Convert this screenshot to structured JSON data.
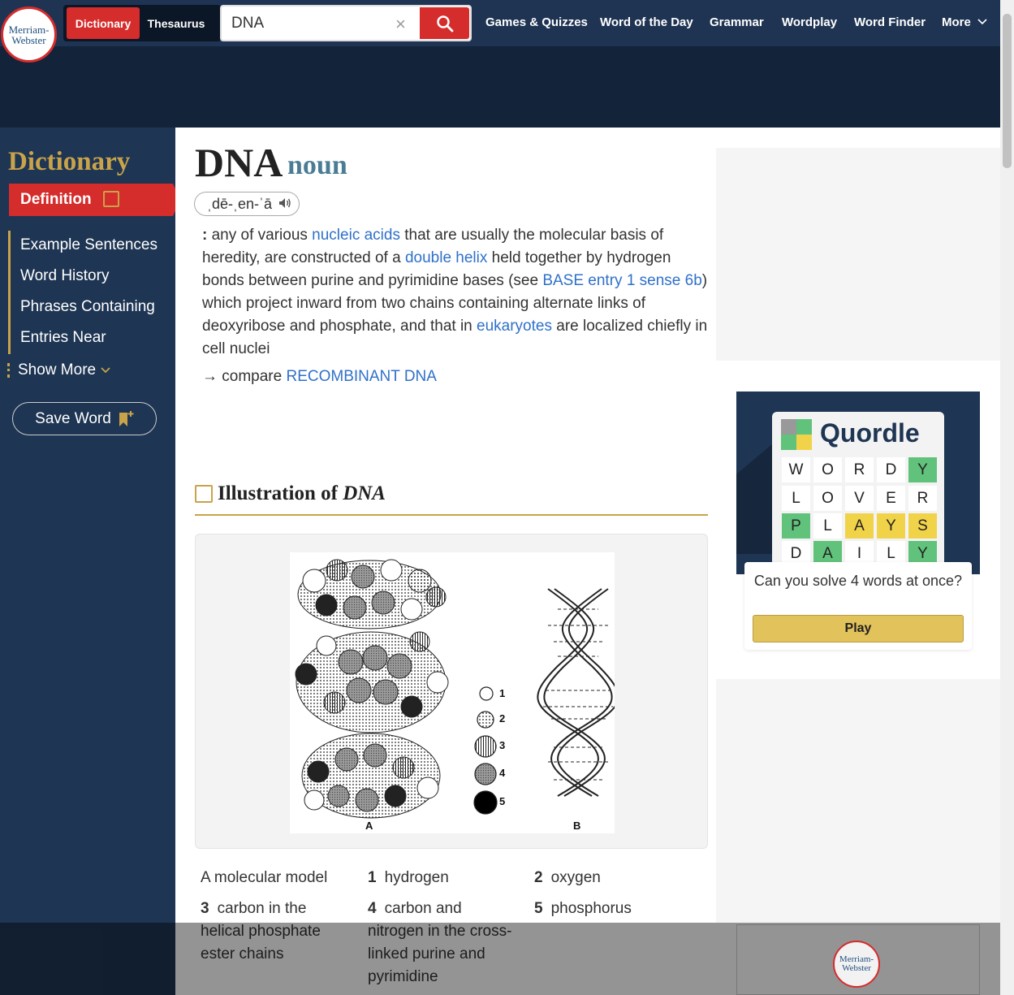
{
  "header": {
    "logo_line1": "Merriam-",
    "logo_line2": "Webster",
    "tab_dictionary": "Dictionary",
    "tab_thesaurus": "Thesaurus",
    "search_value": "DNA",
    "clear_glyph": "×",
    "nav": [
      "Games & Quizzes",
      "Word of the Day",
      "Grammar",
      "Wordplay",
      "Word Finder",
      "More"
    ]
  },
  "sidebar": {
    "title": "Dictionary",
    "active": "Definition",
    "items": [
      "Example Sentences",
      "Word History",
      "Phrases Containing",
      "Entries Near"
    ],
    "show_more": "Show More",
    "save_word": "Save Word"
  },
  "entry": {
    "headword": "DNA",
    "pos": "noun",
    "pronunciation": "ˌdē-ˌen-ˈā",
    "def_colon": ":",
    "def_parts": {
      "p1": " any of various ",
      "l1": "nucleic acids",
      "p2": " that are usually the molecular basis of heredity, are constructed of a ",
      "l2": "double helix",
      "p3": " held together by hydrogen bonds between purine and pyrimidine bases (see ",
      "l3": "BASE entry 1 sense 6b",
      "p4": ") which project inward from two chains containing alternate links of deoxyribose and phosphate, and that in ",
      "l4": "eukaryotes",
      "p5": " are localized chiefly in cell nuclei"
    },
    "compare_prefix": "→ compare ",
    "compare_link": "RECOMBINANT DNA"
  },
  "illustration": {
    "title_prefix": "Illustration of ",
    "title_word": "DNA",
    "label_a": "A",
    "label_b": "B",
    "key_numbers": [
      "1",
      "2",
      "3",
      "4",
      "5"
    ],
    "legend": [
      {
        "num": "",
        "text": "A molecular model"
      },
      {
        "num": "1",
        "text": "hydrogen"
      },
      {
        "num": "2",
        "text": "oxygen"
      },
      {
        "num": "3",
        "text": "carbon in the helical phosphate ester chains"
      },
      {
        "num": "4",
        "text": "carbon and nitrogen in the cross-linked purine and pyrimidine"
      },
      {
        "num": "5",
        "text": "phosphorus"
      }
    ]
  },
  "promo": {
    "game_name": "Quordle",
    "rows": [
      [
        "W",
        "O",
        "R",
        "D",
        "Y"
      ],
      [
        "L",
        "O",
        "V",
        "E",
        "R"
      ],
      [
        "P",
        "L",
        "A",
        "Y",
        "S"
      ],
      [
        "D",
        "A",
        "I",
        "L",
        "Y"
      ]
    ],
    "question": "Can you solve 4 words at once?",
    "play": "Play"
  },
  "colors": {
    "brand_red": "#d52c2c",
    "gold": "#c9a34a",
    "navy": "#1e3553",
    "link": "#2f71c9"
  }
}
